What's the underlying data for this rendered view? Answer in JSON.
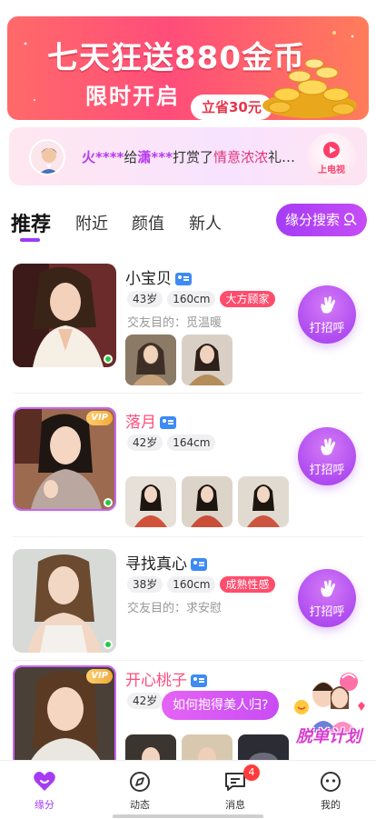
{
  "banner": {
    "title": "七天狂送880金币",
    "subtitle": "限时开启",
    "pill": "立省30元"
  },
  "tip": {
    "sender": "火****",
    "verb1": "给",
    "receiver": "潇***",
    "verb2": "打赏了",
    "gift": "情意浓浓",
    "tail": "礼…",
    "tv_label": "上电视"
  },
  "tabs": {
    "items": [
      "推荐",
      "附近",
      "颜值",
      "新人"
    ],
    "active": "推荐",
    "search_label": "缘分搜索"
  },
  "users": [
    {
      "name": "小宝贝",
      "age": "43岁",
      "height": "160cm",
      "tag": "大方顾家",
      "purpose": "交友目的：觅温暖",
      "vip": false,
      "online": true
    },
    {
      "name": "落月",
      "age": "42岁",
      "height": "164cm",
      "tag": "",
      "purpose": "",
      "vip": true,
      "online": true
    },
    {
      "name": "寻找真心",
      "age": "38岁",
      "height": "160cm",
      "tag": "成熟性感",
      "purpose": "交友目的：求安慰",
      "vip": false,
      "online": true
    },
    {
      "name": "开心桃子",
      "age": "42岁",
      "height": "",
      "tag": "",
      "purpose": "",
      "vip": true,
      "online": true
    }
  ],
  "vip_label": "VIP",
  "hello_label": "打招呼",
  "speech_bubble": "如何抱得美人归?",
  "promo_label": "脱单计划",
  "nav": {
    "items": [
      "缘分",
      "动态",
      "消息",
      "我的"
    ],
    "active": "缘分",
    "message_badge": "4"
  },
  "colors": {
    "accent": "#a53cf3",
    "pink_name": "#ff4d7d",
    "hot_tag": "#ff4d6d",
    "online": "#28c840"
  }
}
